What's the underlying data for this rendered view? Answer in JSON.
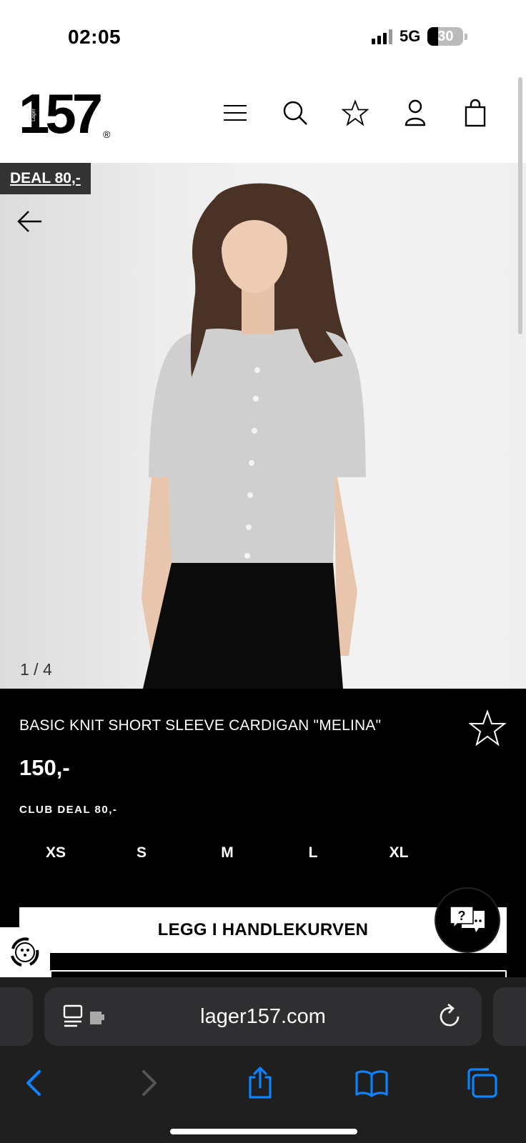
{
  "status_bar": {
    "time": "02:05",
    "network": "5G",
    "battery": "30"
  },
  "header": {
    "logo_number": "157",
    "logo_lager": "Lager",
    "logo_registered": "®",
    "icons": [
      "menu-icon",
      "search-icon",
      "star-icon",
      "user-icon",
      "shopping-bag-icon"
    ]
  },
  "product_image": {
    "deal_badge": "DEAL 80,-",
    "counter": "1 / 4"
  },
  "product": {
    "title": "BASIC KNIT SHORT SLEEVE CARDIGAN \"MELINA\"",
    "price": "150,-",
    "club_deal": "CLUB DEAL 80,-",
    "sizes": [
      "XS",
      "S",
      "M",
      "L",
      "XL"
    ],
    "add_to_cart": "LEGG I HANDLEKURVEN",
    "chat_label": "?"
  },
  "browser": {
    "url": "lager157.com",
    "accent_color": "#0a84ff"
  }
}
